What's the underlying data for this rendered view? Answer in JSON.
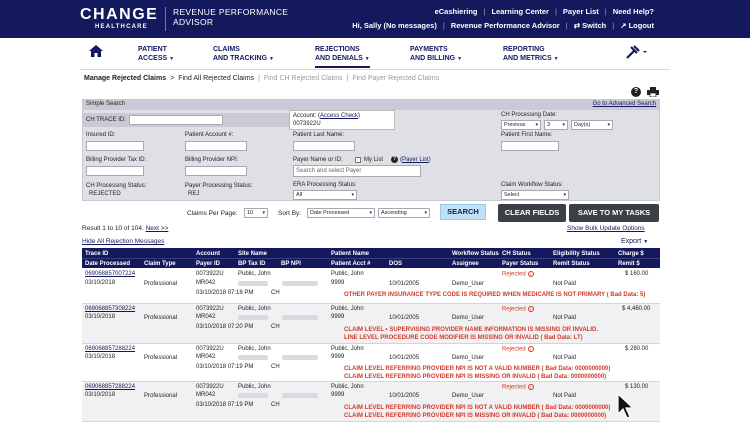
{
  "brand": {
    "logo": "CHANGE",
    "logo_sub": "HEALTHCARE",
    "product_line1": "REVENUE PERFORMANCE",
    "product_line2": "ADVISOR"
  },
  "top_links": {
    "row1": [
      "eCashiering",
      "Learning Center",
      "Payer List",
      "Need Help?"
    ],
    "greeting": "Hi, Sally (No messages)",
    "row2": [
      "Revenue Performance Advisor",
      "Switch",
      "Logout"
    ]
  },
  "nav": {
    "items": [
      {
        "line1": "PATIENT",
        "line2": "ACCESS"
      },
      {
        "line1": "CLAIMS",
        "line2": "AND TRACKING"
      },
      {
        "line1": "REJECTIONS",
        "line2": "AND DENIALS"
      },
      {
        "line1": "PAYMENTS",
        "line2": "AND BILLING"
      },
      {
        "line1": "REPORTING",
        "line2": "AND METRICS"
      }
    ]
  },
  "breadcrumb": {
    "current": "Manage Rejected Claims",
    "sep": ">",
    "link": "Find All Rejected Claims",
    "tab2": "Find CH Rejected Claims",
    "tab3": "Find Payer Rejected Claims"
  },
  "search": {
    "title": "Simple Search",
    "advanced": "Go to Advanced Search",
    "trace_id": "CH TRACE ID:",
    "account_label": "Account:",
    "access_check": "Access Check",
    "account_value": "0073922U",
    "ch_processing_date": "CH Processing Date:",
    "date_sel1": "Previous",
    "date_sel2": "3",
    "date_sel3": "Day(s)",
    "insured_id": "Insured ID:",
    "patient_account": "Patient Account #:",
    "patient_last": "Patient Last Name:",
    "patient_first": "Patient First Name:",
    "billing_tax": "Billing Provider Tax ID:",
    "billing_npi": "Billing Provider NPI:",
    "payer_name": "Payer Name or ID:",
    "my_list": "My List",
    "payer_list": "Payer List",
    "payer_placeholder": "Search and select Payer",
    "ch_status_label": "CH Processing Status:",
    "ch_status_value": "REJECTED",
    "payer_status_label": "Payer Processing Status:",
    "payer_status_value": "REJ",
    "era_status_label": "ERA Processing Status:",
    "era_status_value": "All",
    "workflow_label": "Claim Workflow Status:",
    "workflow_value": "Select"
  },
  "controls": {
    "claims_per_page_label": "Claims Per Page:",
    "claims_per_page": "10",
    "sort_by_label": "Sort By:",
    "sort_by": "Date Processed",
    "order": "Ascending",
    "search_btn": "SEARCH",
    "clear_btn": "CLEAR FIELDS",
    "save_btn": "SAVE TO MY TASKS",
    "result_text": "Result 1 to 10 of 104.",
    "next": "Next >>",
    "bulk": "Show Bulk Update Options",
    "hide_all": "Hide All Rejection Messages",
    "export": "Export"
  },
  "table": {
    "head1": [
      "Trace ID",
      "Account",
      "Site Name",
      "Patient Name",
      "Workflow Status",
      "CH Status",
      "Eligibility Status",
      "Charge $"
    ],
    "head2": [
      "Date Processed",
      "Claim Type",
      "Payer ID",
      "BP Tax ID",
      "BP NPI",
      "Patient Acct #",
      "DOS",
      "Assignee",
      "Payer Status",
      "Remit Status",
      "Remit $"
    ],
    "rows": [
      {
        "trace": "069068857007224",
        "account": "0073922U",
        "site": "Public, John",
        "patient": "Public, John",
        "status": "Rejected",
        "charge": "$ 160.00",
        "date": "03/10/2018",
        "type": "Professional",
        "payer_id": "MR042",
        "acct": "9999",
        "dos": "10/01/2005",
        "assignee": "Demo_User",
        "remit": "Not Paid",
        "ch_time": "03/10/2018 07:18 PM",
        "ch": "CH",
        "errors": [
          "OTHER PAYER INSURANCE TYPE CODE IS REQUIRED WHEN MEDICARE IS NOT PRIMARY ( Bad Data: 5)"
        ]
      },
      {
        "trace": "069068857308224",
        "account": "0073922U",
        "site": "Public, John",
        "patient": "Public, John",
        "status": "Rejected",
        "charge": "$ 4,460.00",
        "date": "03/10/2018",
        "type": "Professional",
        "payer_id": "MR042",
        "acct": "9999",
        "dos": "10/01/2005",
        "assignee": "Demo_User",
        "remit": "Not Paid",
        "ch_time": "03/10/2018 07:20 PM",
        "ch": "CH",
        "errors": [
          "CLAIM LEVEL • SUPERVISING PROVIDER NAME INFORMATION IS MISSING OR INVALID.",
          "LINE LEVEL PROCEDURE CODE MODIFIER IS MISSING OR INVALID ( Bad Data: LT)"
        ]
      },
      {
        "trace": "069068857288224",
        "account": "0073922U",
        "site": "Public, John",
        "patient": "Public, John",
        "status": "Rejected",
        "charge": "$ 280.00",
        "date": "03/10/2018",
        "type": "Professional",
        "payer_id": "MR042",
        "acct": "9999",
        "dos": "10/01/2005",
        "assignee": "Demo_User",
        "remit": "Not Paid",
        "ch_time": "03/10/2018 07:19 PM",
        "ch": "CH",
        "errors": [
          "CLAIM LEVEL REFERRING PROVIDER NPI IS NOT A VALID NUMBER ( Bad Data: 0000000000)",
          "CLAIM LEVEL REFERRING PROVIDER NPI IS MISSING OR INVALID ( Bad Data: 0000000000)"
        ]
      },
      {
        "trace": "069068857288224",
        "account": "0073922U",
        "site": "Public, John",
        "patient": "Public, John",
        "status": "Rejected",
        "charge": "$ 130.00",
        "date": "03/10/2018",
        "type": "Professional",
        "payer_id": "MR042",
        "acct": "9999",
        "dos": "10/01/2005",
        "assignee": "Demo_User",
        "remit": "Not Paid",
        "ch_time": "03/10/2018 07:19 PM",
        "ch": "CH",
        "errors": [
          "CLAIM LEVEL REFERRING PROVIDER NPI IS NOT A VALID NUMBER ( Bad Data: 0000000000)",
          "CLAIM LEVEL REFERRING PROVIDER NPI IS MISSING OR INVALID ( Bad Data: 0000000000)"
        ]
      }
    ]
  },
  "colors": {
    "brand_navy": "#14195e",
    "error_red": "#d23a2a",
    "panel_gray": "#dfe0e6"
  }
}
